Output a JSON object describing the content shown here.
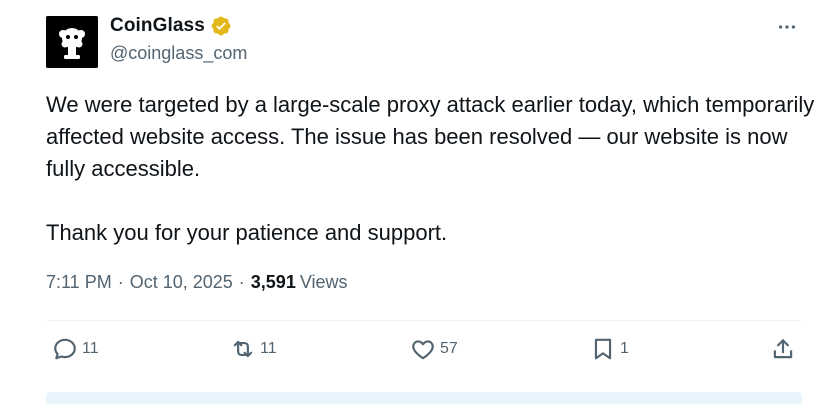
{
  "author": {
    "display_name": "CoinGlass",
    "handle": "@coinglass_com",
    "verified": true,
    "verified_badge_color": "#e2b719",
    "avatar_icon": "coinglass-logo"
  },
  "tweet": {
    "paragraphs": [
      "We were targeted by a large-scale proxy attack earlier today, which temporarily affected website access. The issue has been resolved — our website is now fully accessible.",
      "Thank you for your patience and support."
    ]
  },
  "meta": {
    "time": "7:11 PM",
    "date": "Oct 10, 2025",
    "separator": "·",
    "views_count": "3,591",
    "views_label": "Views"
  },
  "actions": {
    "replies": "11",
    "reposts": "11",
    "likes": "57",
    "bookmarks": "1"
  },
  "colors": {
    "text_primary": "#0f1419",
    "text_secondary": "#536471",
    "divider": "#eff3f4"
  }
}
